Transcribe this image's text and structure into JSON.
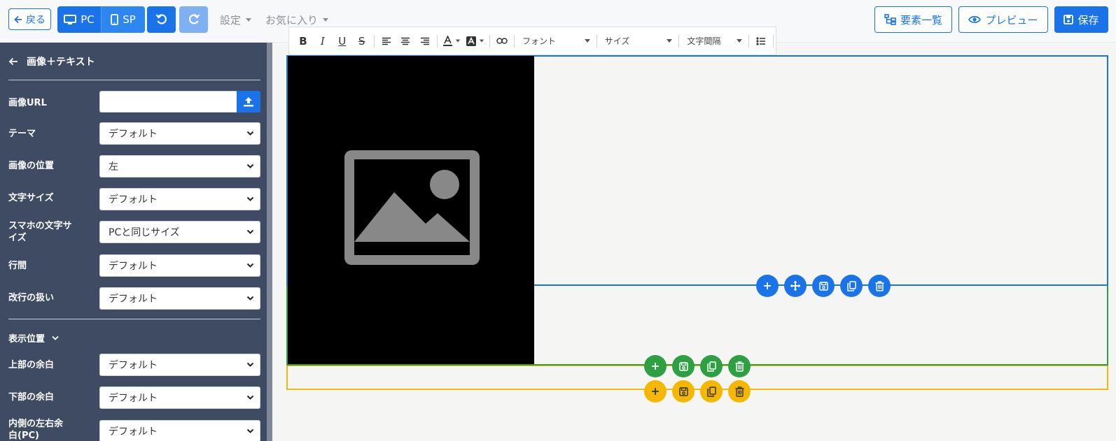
{
  "header": {
    "back_label": "戻る",
    "pc_label": "PC",
    "sp_label": "SP",
    "settings_label": "設定",
    "favorites_label": "お気に入り",
    "elements_label": "要素一覧",
    "preview_label": "プレビュー",
    "save_label": "保存"
  },
  "toolbar": {
    "bold": "B",
    "italic": "I",
    "underline": "U",
    "strike": "S",
    "font_label": "フォント",
    "size_label": "サイズ",
    "spacing_label": "文字間隔"
  },
  "sidebar": {
    "title": "画像＋テキスト",
    "fields": [
      {
        "label": "画像URL",
        "value": ""
      },
      {
        "label": "テーマ",
        "value": "デフォルト"
      },
      {
        "label": "画像の位置",
        "value": "左"
      },
      {
        "label": "文字サイズ",
        "value": "デフォルト"
      },
      {
        "label": "スマホの文字サイズ",
        "value": "PCと同じサイズ"
      },
      {
        "label": "行間",
        "value": "デフォルト"
      },
      {
        "label": "改行の扱い",
        "value": "デフォルト"
      }
    ],
    "section_label": "表示位置",
    "position_fields": [
      {
        "label": "上部の余白",
        "value": "デフォルト"
      },
      {
        "label": "下部の余白",
        "value": "デフォルト"
      },
      {
        "label": "内側の左右余白(PC)",
        "value": "デフォルト"
      }
    ]
  },
  "colors": {
    "primary": "#1a73e8",
    "sidebar_bg": "#3e4b63",
    "green": "#2ea043",
    "yellow": "#f5b800"
  }
}
